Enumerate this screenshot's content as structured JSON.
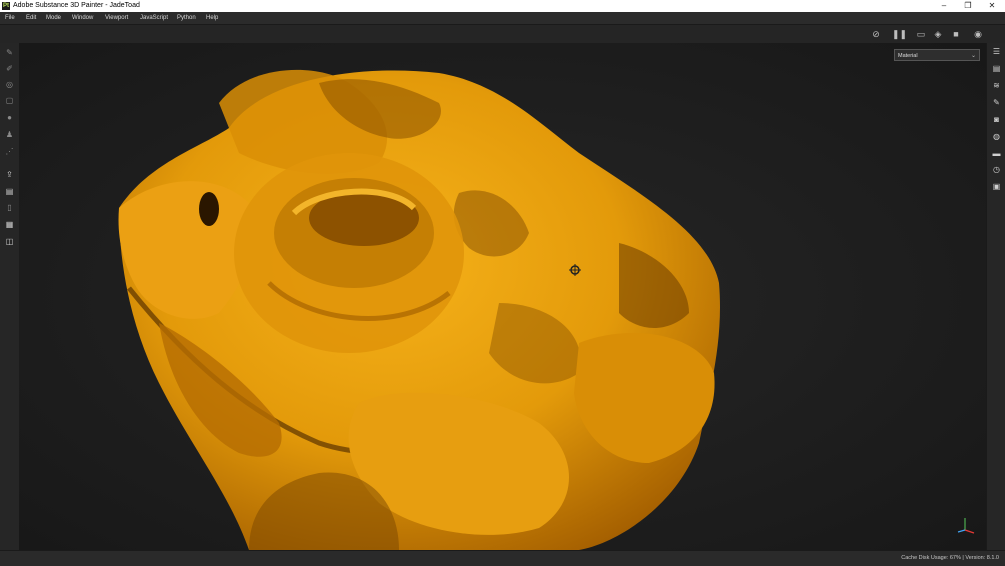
{
  "window": {
    "app_icon_letter": "Pt",
    "title": "Adobe Substance 3D Painter - JadeToad",
    "controls": {
      "minimize": "–",
      "maximize": "❐",
      "close": "✕"
    }
  },
  "menu": [
    "File",
    "Edit",
    "Mode",
    "Window",
    "Viewport",
    "JavaScript",
    "Python",
    "Help"
  ],
  "toolbar": {
    "icons": [
      "link-off-icon",
      "pause-icon",
      "camera-view-icon",
      "cube-view-icon",
      "video-camera-icon",
      "screenshot-icon"
    ]
  },
  "left_tools": [
    "paint-brush-icon",
    "eraser-icon",
    "projection-icon",
    "geometry-mask-icon",
    "smudge-icon",
    "clone-icon",
    "picker-icon",
    "export-icon",
    "bake-icon",
    "delete-icon",
    "document-icon",
    "box-icon"
  ],
  "right_panels": [
    "layers-panel-icon",
    "texture-set-icon",
    "stack-icon",
    "brush-settings-icon",
    "display-settings-icon",
    "environment-icon",
    "shelf-icon",
    "history-icon",
    "log-icon"
  ],
  "viewport": {
    "mode_select": {
      "value": "Material"
    }
  },
  "status": {
    "cache_label": "Cache Disk Usage:",
    "cache_value": "67%",
    "separator": "|",
    "version_label": "Version: 8.1.0"
  },
  "colors": {
    "model_gold": "#e39a0a",
    "model_shadow": "#6b3c00",
    "background": "#1e1e1e"
  }
}
